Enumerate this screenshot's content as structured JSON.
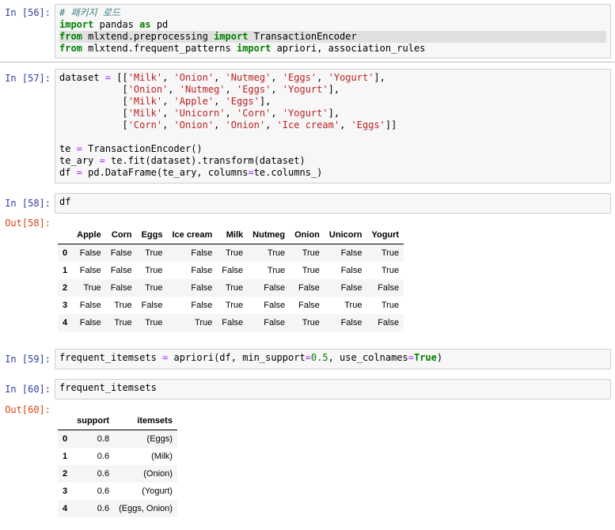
{
  "cells": {
    "c56": {
      "prompt": "In [56]:",
      "lines": [
        [
          {
            "t": "# 패키지 로드",
            "c": "cm"
          }
        ],
        [
          {
            "t": "import",
            "c": "kw"
          },
          {
            "t": " pandas "
          },
          {
            "t": "as",
            "c": "kw"
          },
          {
            "t": " pd"
          }
        ],
        [
          {
            "t": "from",
            "c": "kw"
          },
          {
            "t": " mlxtend.preprocessing "
          },
          {
            "t": "import",
            "c": "kw"
          },
          {
            "t": " TransactionEncoder"
          }
        ],
        [
          {
            "t": "from",
            "c": "kw"
          },
          {
            "t": " mlxtend.frequent_patterns "
          },
          {
            "t": "import",
            "c": "kw"
          },
          {
            "t": " apriori, association_rules"
          }
        ]
      ]
    },
    "c57": {
      "prompt": "In [57]:",
      "lines": [
        [
          {
            "t": "dataset "
          },
          {
            "t": "=",
            "c": "op"
          },
          {
            "t": " [["
          },
          {
            "t": "'Milk'",
            "c": "st"
          },
          {
            "t": ", "
          },
          {
            "t": "'Onion'",
            "c": "st"
          },
          {
            "t": ", "
          },
          {
            "t": "'Nutmeg'",
            "c": "st"
          },
          {
            "t": ", "
          },
          {
            "t": "'Eggs'",
            "c": "st"
          },
          {
            "t": ", "
          },
          {
            "t": "'Yogurt'",
            "c": "st"
          },
          {
            "t": "],"
          }
        ],
        [
          {
            "t": "           ["
          },
          {
            "t": "'Onion'",
            "c": "st"
          },
          {
            "t": ", "
          },
          {
            "t": "'Nutmeg'",
            "c": "st"
          },
          {
            "t": ", "
          },
          {
            "t": "'Eggs'",
            "c": "st"
          },
          {
            "t": ", "
          },
          {
            "t": "'Yogurt'",
            "c": "st"
          },
          {
            "t": "],"
          }
        ],
        [
          {
            "t": "           ["
          },
          {
            "t": "'Milk'",
            "c": "st"
          },
          {
            "t": ", "
          },
          {
            "t": "'Apple'",
            "c": "st"
          },
          {
            "t": ", "
          },
          {
            "t": "'Eggs'",
            "c": "st"
          },
          {
            "t": "],"
          }
        ],
        [
          {
            "t": "           ["
          },
          {
            "t": "'Milk'",
            "c": "st"
          },
          {
            "t": ", "
          },
          {
            "t": "'Unicorn'",
            "c": "st"
          },
          {
            "t": ", "
          },
          {
            "t": "'Corn'",
            "c": "st"
          },
          {
            "t": ", "
          },
          {
            "t": "'Yogurt'",
            "c": "st"
          },
          {
            "t": "],"
          }
        ],
        [
          {
            "t": "           ["
          },
          {
            "t": "'Corn'",
            "c": "st"
          },
          {
            "t": ", "
          },
          {
            "t": "'Onion'",
            "c": "st"
          },
          {
            "t": ", "
          },
          {
            "t": "'Onion'",
            "c": "st"
          },
          {
            "t": ", "
          },
          {
            "t": "'Ice cream'",
            "c": "st"
          },
          {
            "t": ", "
          },
          {
            "t": "'Eggs'",
            "c": "st"
          },
          {
            "t": "]]"
          }
        ],
        [
          {
            "t": ""
          }
        ],
        [
          {
            "t": "te "
          },
          {
            "t": "=",
            "c": "op"
          },
          {
            "t": " TransactionEncoder()"
          }
        ],
        [
          {
            "t": "te_ary "
          },
          {
            "t": "=",
            "c": "op"
          },
          {
            "t": " te.fit(dataset).transform(dataset)"
          }
        ],
        [
          {
            "t": "df "
          },
          {
            "t": "=",
            "c": "op"
          },
          {
            "t": " pd.DataFrame(te_ary, columns"
          },
          {
            "t": "=",
            "c": "op"
          },
          {
            "t": "te.columns_)"
          }
        ]
      ]
    },
    "c58": {
      "prompt": "In [58]:",
      "out_prompt": "Out[58]:",
      "lines": [
        [
          {
            "t": "df"
          }
        ]
      ]
    },
    "c59": {
      "prompt": "In [59]:",
      "lines": [
        [
          {
            "t": "frequent_itemsets "
          },
          {
            "t": "=",
            "c": "op"
          },
          {
            "t": " apriori(df, min_support"
          },
          {
            "t": "=",
            "c": "op"
          },
          {
            "t": "0.5",
            "c": "nm"
          },
          {
            "t": ", use_colnames"
          },
          {
            "t": "=",
            "c": "op"
          },
          {
            "t": "True",
            "c": "kw"
          },
          {
            "t": ")"
          }
        ]
      ]
    },
    "c60": {
      "prompt": "In [60]:",
      "out_prompt": "Out[60]:",
      "lines": [
        [
          {
            "t": "frequent_itemsets"
          }
        ]
      ]
    }
  },
  "df_table": {
    "columns": [
      "",
      "Apple",
      "Corn",
      "Eggs",
      "Ice cream",
      "Milk",
      "Nutmeg",
      "Onion",
      "Unicorn",
      "Yogurt"
    ],
    "rows": [
      [
        "0",
        "False",
        "False",
        "True",
        "False",
        "True",
        "True",
        "True",
        "False",
        "True"
      ],
      [
        "1",
        "False",
        "False",
        "True",
        "False",
        "False",
        "True",
        "True",
        "False",
        "True"
      ],
      [
        "2",
        "True",
        "False",
        "True",
        "False",
        "True",
        "False",
        "False",
        "False",
        "False"
      ],
      [
        "3",
        "False",
        "True",
        "False",
        "False",
        "True",
        "False",
        "False",
        "True",
        "True"
      ],
      [
        "4",
        "False",
        "True",
        "True",
        "True",
        "False",
        "False",
        "True",
        "False",
        "False"
      ]
    ]
  },
  "itemsets_table": {
    "columns": [
      "",
      "support",
      "itemsets"
    ],
    "rows": [
      [
        "0",
        "0.8",
        "(Eggs)"
      ],
      [
        "1",
        "0.6",
        "(Milk)"
      ],
      [
        "2",
        "0.6",
        "(Onion)"
      ],
      [
        "3",
        "0.6",
        "(Yogurt)"
      ],
      [
        "4",
        "0.6",
        "(Eggs, Onion)"
      ]
    ]
  }
}
